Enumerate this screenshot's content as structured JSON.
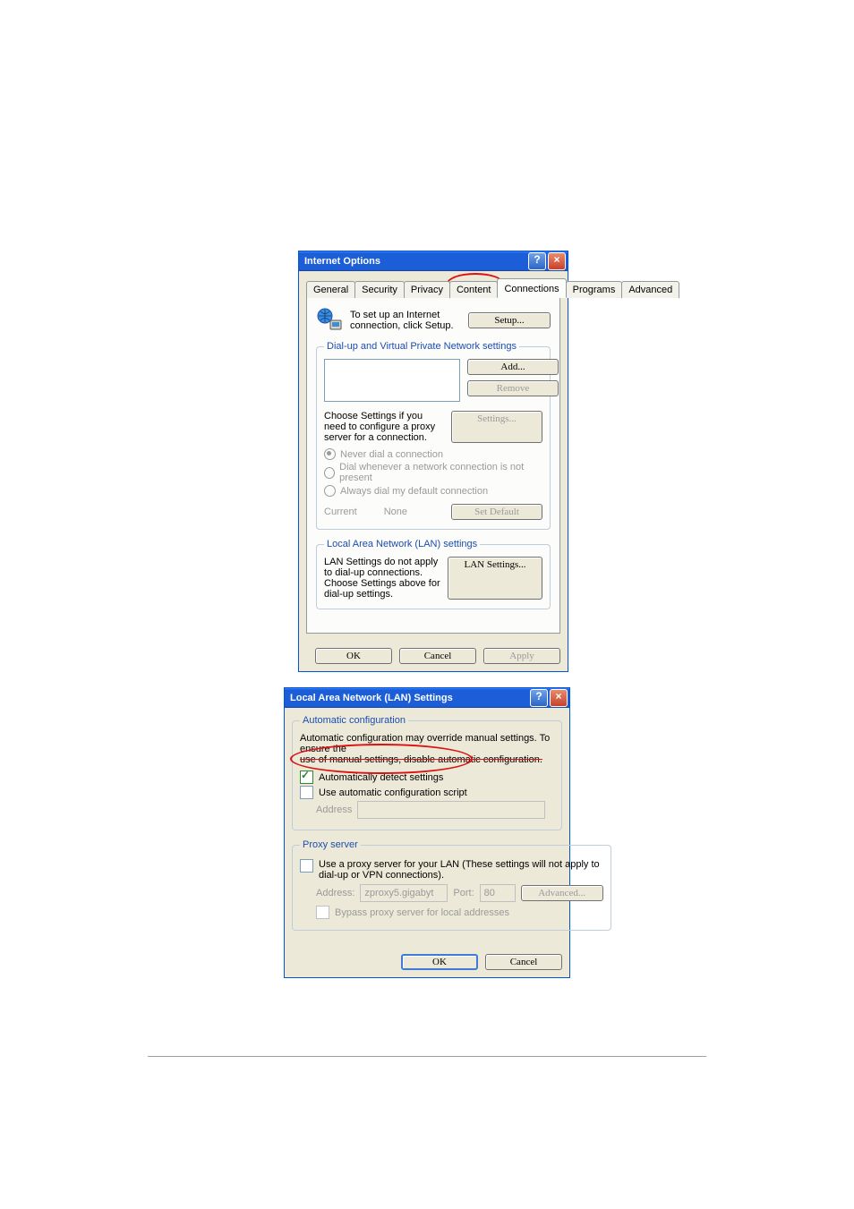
{
  "dialog1": {
    "title": "Internet Options",
    "tabs": [
      "General",
      "Security",
      "Privacy",
      "Content",
      "Connections",
      "Programs",
      "Advanced"
    ],
    "setup_text": "To set up an Internet connection, click Setup.",
    "setup_btn": "Setup...",
    "group1_legend": "Dial-up and Virtual Private Network settings",
    "add_btn": "Add...",
    "remove_btn": "Remove",
    "settings_hint": "Choose Settings if you need to configure a proxy server for a connection.",
    "settings_btn": "Settings...",
    "radio1": "Never dial a connection",
    "radio2": "Dial whenever a network connection is not present",
    "radio3": "Always dial my default connection",
    "current_lbl": "Current",
    "current_val": "None",
    "set_default_btn": "Set Default",
    "group2_legend": "Local Area Network (LAN) settings",
    "lan_text": "LAN Settings do not apply to dial-up connections. Choose Settings above for dial-up settings.",
    "lan_btn": "LAN Settings...",
    "ok": "OK",
    "cancel": "Cancel",
    "apply": "Apply"
  },
  "dialog2": {
    "title": "Local Area Network (LAN) Settings",
    "group1_legend": "Automatic configuration",
    "auto_desc1": "Automatic configuration may override manual settings.  To ensure the",
    "auto_desc2": "use of manual settings, disable automatic configuration.",
    "auto_detect": "Automatically detect settings",
    "auto_script": "Use automatic configuration script",
    "address_lbl": "Address",
    "group2_legend": "Proxy server",
    "proxy_desc": "Use a proxy server for your LAN (These settings will not apply to dial-up or VPN connections).",
    "addr_lbl": "Address:",
    "addr_val": "zproxy5.gigabyt",
    "port_lbl": "Port:",
    "port_val": "80",
    "advanced_btn": "Advanced...",
    "bypass": "Bypass proxy server for local addresses",
    "ok": "OK",
    "cancel": "Cancel"
  }
}
